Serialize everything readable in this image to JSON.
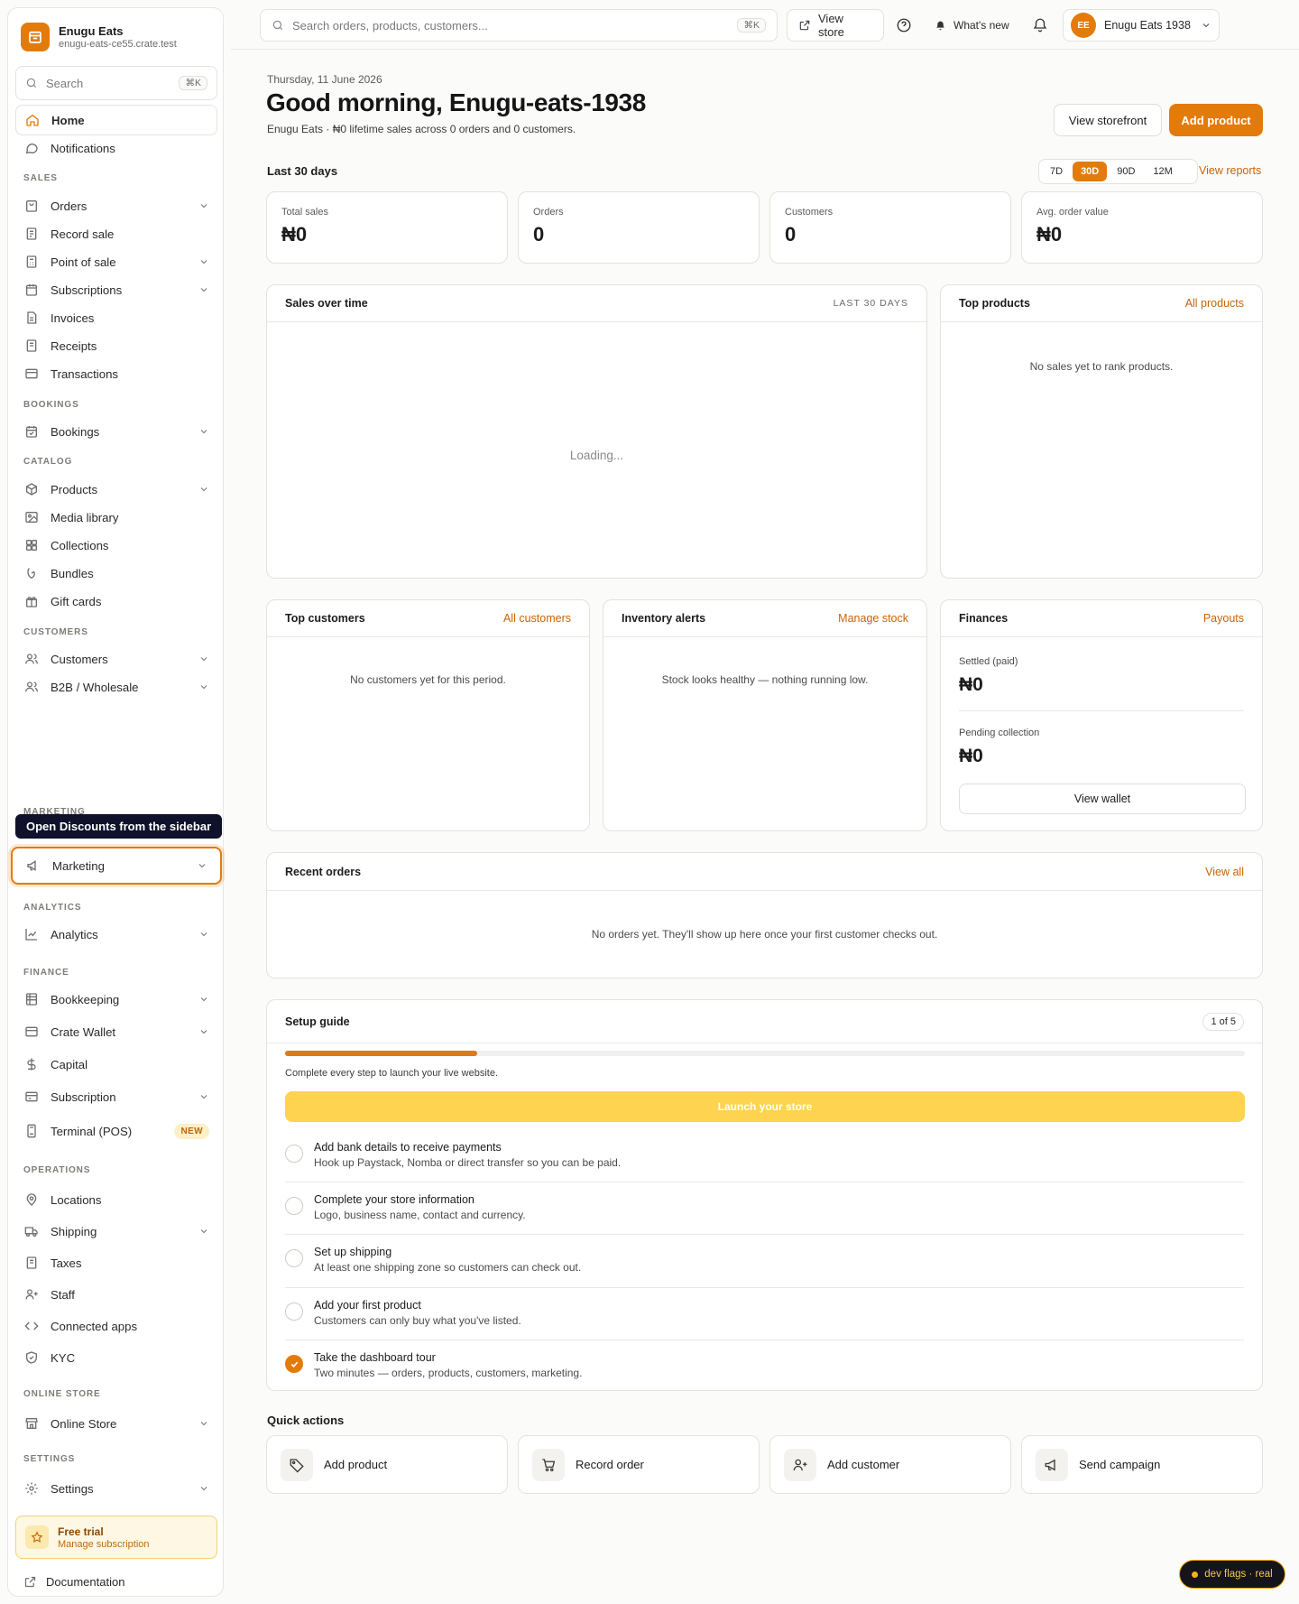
{
  "brand": {
    "name": "Enugu Eats",
    "domain": "enugu-eats-ce55.crate.test"
  },
  "sidebar": {
    "search_label": "Search",
    "search_shortcut": "⌘K",
    "home": "Home",
    "notifications": "Notifications",
    "sections": {
      "sales": "SALES",
      "bookings": "BOOKINGS",
      "catalog": "CATALOG",
      "customers": "CUSTOMERS",
      "marketing": "MARKETING",
      "analytics": "ANALYTICS",
      "finance": "FINANCE",
      "operations": "OPERATIONS",
      "online_store": "ONLINE STORE",
      "settings": "SETTINGS"
    },
    "items": {
      "orders": "Orders",
      "record_sale": "Record sale",
      "point_of_sale": "Point of sale",
      "subscriptions": "Subscriptions",
      "invoices": "Invoices",
      "receipts": "Receipts",
      "transactions": "Transactions",
      "bookings": "Bookings",
      "products": "Products",
      "media_library": "Media library",
      "collections": "Collections",
      "bundles": "Bundles",
      "gift_cards": "Gift cards",
      "customers": "Customers",
      "b2b": "B2B / Wholesale",
      "marketing": "Marketing",
      "analytics": "Analytics",
      "bookkeeping": "Bookkeeping",
      "crate_wallet": "Crate Wallet",
      "capital": "Capital",
      "subscription": "Subscription",
      "terminal": "Terminal (POS)",
      "locations": "Locations",
      "shipping": "Shipping",
      "taxes": "Taxes",
      "staff": "Staff",
      "connected_apps": "Connected apps",
      "kyc": "KYC",
      "online_store": "Online Store",
      "settings": "Settings"
    },
    "terminal_badge": "NEW",
    "tooltip": "Open Discounts from the sidebar",
    "trial_title": "Free trial",
    "trial_sub": "Manage subscription",
    "documentation": "Documentation"
  },
  "topbar": {
    "search_placeholder": "Search orders, products, customers...",
    "search_shortcut": "⌘K",
    "view_store": "View store",
    "whats_new": "What's new",
    "avatar_initials": "EE",
    "account_name": "Enugu Eats 1938"
  },
  "header": {
    "date": "Thursday, 11 June 2026",
    "greeting": "Good morning, Enugu-eats-1938",
    "subtitle": "Enugu Eats · ₦0 lifetime sales across 0 orders and 0 customers.",
    "view_storefront": "View storefront",
    "add_product": "Add product"
  },
  "period": {
    "title": "Last 30 days",
    "options": [
      "7D",
      "30D",
      "90D",
      "12M"
    ],
    "selected": "30D",
    "view_reports": "View reports"
  },
  "stats": [
    {
      "label": "Total sales",
      "value": "₦0"
    },
    {
      "label": "Orders",
      "value": "0"
    },
    {
      "label": "Customers",
      "value": "0"
    },
    {
      "label": "Avg. order value",
      "value": "₦0"
    }
  ],
  "sales_over_time": {
    "title": "Sales over time",
    "range": "LAST 30 DAYS",
    "status": "Loading..."
  },
  "top_products": {
    "title": "Top products",
    "link": "All products",
    "empty": "No sales yet to rank products."
  },
  "top_customers": {
    "title": "Top customers",
    "link": "All customers",
    "empty": "No customers yet for this period."
  },
  "inventory": {
    "title": "Inventory alerts",
    "link": "Manage stock",
    "empty": "Stock looks healthy — nothing running low."
  },
  "finances": {
    "title": "Finances",
    "link": "Payouts",
    "settled_label": "Settled (paid)",
    "settled_value": "₦0",
    "pending_label": "Pending collection",
    "pending_value": "₦0",
    "wallet_button": "View wallet"
  },
  "recent_orders": {
    "title": "Recent orders",
    "link": "View all",
    "empty": "No orders yet. They'll show up here once your first customer checks out."
  },
  "setup": {
    "title": "Setup guide",
    "counter": "1 of 5",
    "progress": 0.2,
    "hint": "Complete every step to launch your live website.",
    "launch": "Launch your store",
    "steps": [
      {
        "title": "Add bank details to receive payments",
        "desc": "Hook up Paystack, Nomba or direct transfer so you can be paid.",
        "done": false
      },
      {
        "title": "Complete your store information",
        "desc": "Logo, business name, contact and currency.",
        "done": false
      },
      {
        "title": "Set up shipping",
        "desc": "At least one shipping zone so customers can check out.",
        "done": false
      },
      {
        "title": "Add your first product",
        "desc": "Customers can only buy what you've listed.",
        "done": false
      },
      {
        "title": "Take the dashboard tour",
        "desc": "Two minutes — orders, products, customers, marketing.",
        "done": true
      }
    ]
  },
  "quick_actions": {
    "title": "Quick actions",
    "items": [
      {
        "label": "Add product",
        "icon": "tag-icon"
      },
      {
        "label": "Record order",
        "icon": "cart-icon"
      },
      {
        "label": "Add customer",
        "icon": "user-plus-icon"
      },
      {
        "label": "Send campaign",
        "icon": "megaphone-icon"
      }
    ]
  },
  "dev_flags": "dev flags · real",
  "colors": {
    "accent": "#e37b0b",
    "launch": "#fdd34f",
    "tooltip": "#10112b"
  }
}
